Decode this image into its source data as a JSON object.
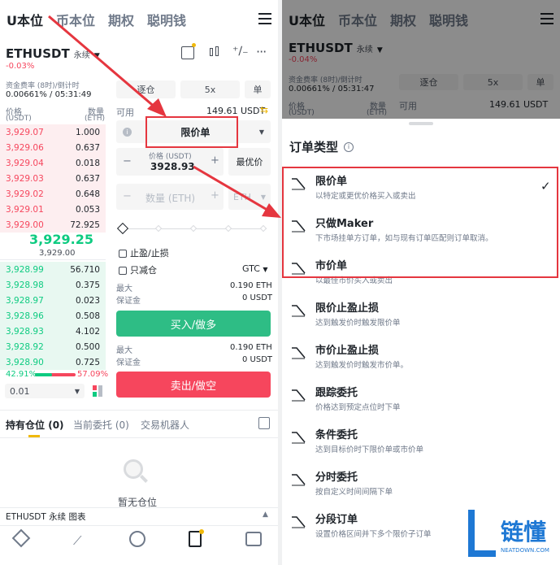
{
  "nav": {
    "tabs": [
      "U本位",
      "币本位",
      "期权",
      "聪明钱"
    ]
  },
  "pair": {
    "symbol": "ETHUSDT",
    "type": "永续",
    "change": "-0.03%",
    "change_right": "-0.04%"
  },
  "funding": {
    "label": "资金费率 (8时)/倒计时",
    "value": "0.00661% / 05:31:49",
    "value_right": "0.00661% / 05:31:47"
  },
  "orderbook": {
    "price_header": "价格",
    "price_unit": "(USDT)",
    "qty_header": "数量",
    "qty_unit": "(ETH)",
    "asks": [
      [
        "3,929.07",
        "1.000"
      ],
      [
        "3,929.06",
        "0.637"
      ],
      [
        "3,929.04",
        "0.018"
      ],
      [
        "3,929.03",
        "0.637"
      ],
      [
        "3,929.02",
        "0.648"
      ],
      [
        "3,929.01",
        "0.053"
      ],
      [
        "3,929.00",
        "72.925"
      ]
    ],
    "last_price": "3,929.25",
    "mark_price": "3,929.00",
    "bids": [
      [
        "3,928.99",
        "56.710"
      ],
      [
        "3,928.98",
        "0.375"
      ],
      [
        "3,928.97",
        "0.023"
      ],
      [
        "3,928.96",
        "0.508"
      ],
      [
        "3,928.93",
        "4.102"
      ],
      [
        "3,928.92",
        "0.500"
      ],
      [
        "3,928.90",
        "0.725"
      ]
    ],
    "buy_ratio": "42.91%",
    "sell_ratio": "57.09%",
    "buy_fraction": 0.4291,
    "depth_step": "0.01"
  },
  "form": {
    "margin_mode": "逐仓",
    "leverage": "5x",
    "single": "单",
    "available_label": "可用",
    "available_value": "149.61 USDT",
    "order_type": "限价单",
    "price_label": "价格 (USDT)",
    "price_value": "3928.93",
    "best_price": "最优价",
    "qty_placeholder": "数量 (ETH)",
    "qty_unit": "ETH",
    "tp_sl": "止盈/止损",
    "reduce_only": "只减仓",
    "tif": "GTC",
    "max_label": "最大",
    "max_buy": "0.190 ETH",
    "margin_label": "保证金",
    "margin_buy": "0 USDT",
    "buy_button": "买入/做多",
    "max_sell": "0.190 ETH",
    "margin_sell": "0 USDT",
    "sell_button": "卖出/做空"
  },
  "positions": {
    "tabs": [
      "持有仓位",
      "当前委托",
      "交易机器人"
    ],
    "tab_counts": [
      "(0)",
      "(0)",
      ""
    ],
    "empty": "暂无仓位"
  },
  "chart_bar": {
    "label": "ETHUSDT 永续  图表"
  },
  "sheet": {
    "title": "订单类型",
    "options": [
      {
        "title": "限价单",
        "desc": "以特定或更优价格买入或卖出",
        "selected": true
      },
      {
        "title": "只做Maker",
        "desc": "下市场挂单方订单，如与现有订单匹配则订单取消。",
        "selected": false
      },
      {
        "title": "市价单",
        "desc": "以最佳市价买入或卖出",
        "selected": false
      },
      {
        "title": "限价止盈止损",
        "desc": "达到触发价时触发限价单",
        "selected": false
      },
      {
        "title": "市价止盈止损",
        "desc": "达到触发价时触发市价单。",
        "selected": false
      },
      {
        "title": "跟踪委托",
        "desc": "价格达到预定点位时下单",
        "selected": false
      },
      {
        "title": "条件委托",
        "desc": "达到目标价时下限价单或市价单",
        "selected": false
      },
      {
        "title": "分时委托",
        "desc": "按自定义时间间隔下单",
        "selected": false
      },
      {
        "title": "分段订单",
        "desc": "设置价格区间并下多个限价子订单",
        "selected": false
      }
    ]
  },
  "watermark": {
    "brand": "链懂",
    "site": "NEATDOWN.COM"
  },
  "colors": {
    "red": "#f6465d",
    "green": "#0ecb81",
    "highlight": "#e5363f",
    "accent": "#f0b90b"
  }
}
